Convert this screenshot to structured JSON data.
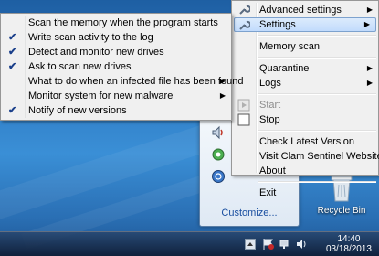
{
  "main_menu": {
    "items": [
      {
        "label": "Advanced settings",
        "submenu": true
      },
      {
        "label": "Settings",
        "submenu": true,
        "highlighted": true
      },
      {
        "label": "Memory scan"
      },
      {
        "label": "Quarantine",
        "submenu": true
      },
      {
        "label": "Logs",
        "submenu": true
      },
      {
        "label": "Start",
        "disabled": true
      },
      {
        "label": "Stop"
      },
      {
        "label": "Check Latest Version"
      },
      {
        "label": "Visit Clam Sentinel Website"
      },
      {
        "label": "About"
      },
      {
        "label": "Exit"
      }
    ]
  },
  "settings_menu": {
    "items": [
      {
        "label": "Scan the memory when the program starts",
        "checked": false
      },
      {
        "label": "Write scan activity to the log",
        "checked": true
      },
      {
        "label": "Detect and monitor new drives",
        "checked": true
      },
      {
        "label": "Ask to scan new drives",
        "checked": true
      },
      {
        "label": "What to do when an infected file has been found",
        "checked": false,
        "submenu": true
      },
      {
        "label": "Monitor system for new malware",
        "checked": false,
        "submenu": true
      },
      {
        "label": "Notify of new versions",
        "checked": true
      }
    ]
  },
  "tray_panel": {
    "customize_label": "Customize..."
  },
  "desktop": {
    "recycle_bin_label": "Recycle Bin"
  },
  "clock": {
    "time": "14:40",
    "date": "03/18/2013"
  },
  "glyphs": {
    "check": "✔",
    "arrow": "▶"
  }
}
